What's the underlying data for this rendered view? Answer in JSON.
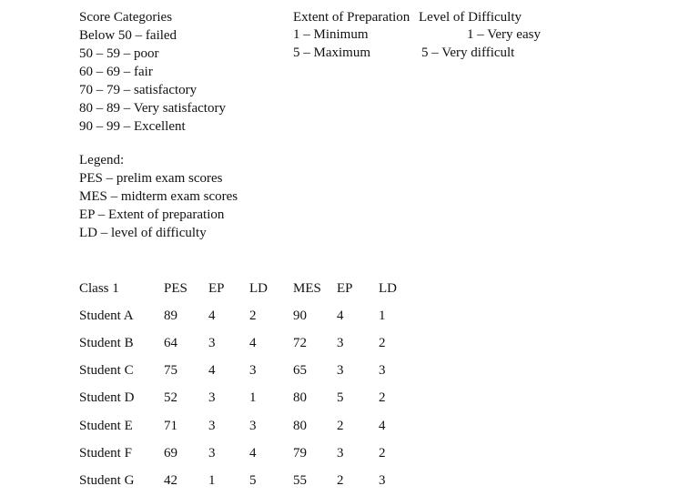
{
  "score_categories": {
    "title": "Score Categories",
    "items": [
      "Below 50 – failed",
      "50 – 59 – poor",
      "60 – 69 – fair",
      "70 – 79 – satisfactory",
      "80 – 89 – Very satisfactory",
      "90 – 99 – Excellent"
    ]
  },
  "extent_of_preparation": {
    "title": "Extent of Preparation",
    "items": [
      "1 – Minimum",
      "5 – Maximum"
    ]
  },
  "level_of_difficulty": {
    "title": "Level of Difficulty",
    "items": [
      "1 – Very easy",
      "5 – Very difficult"
    ]
  },
  "legend": {
    "title": "Legend:",
    "items": [
      "PES – prelim exam scores",
      "MES – midterm exam scores",
      "EP – Extent of preparation",
      "LD – level of difficulty"
    ]
  },
  "table": {
    "headers": [
      "Class 1",
      "PES",
      "EP",
      "LD",
      "MES",
      "EP",
      "LD"
    ],
    "rows": [
      [
        "Student A",
        "89",
        "4",
        "2",
        "90",
        "4",
        "1"
      ],
      [
        "Student B",
        "64",
        "3",
        "4",
        "72",
        "3",
        "2"
      ],
      [
        "Student C",
        "75",
        "4",
        "3",
        "65",
        "3",
        "3"
      ],
      [
        "Student D",
        "52",
        "3",
        "1",
        "80",
        "5",
        "2"
      ],
      [
        "Student E",
        "71",
        "3",
        "3",
        "80",
        "2",
        "4"
      ],
      [
        "Student F",
        "69",
        "3",
        "4",
        "79",
        "3",
        "2"
      ],
      [
        "Student G",
        "42",
        "1",
        "5",
        "55",
        "2",
        "3"
      ]
    ]
  }
}
